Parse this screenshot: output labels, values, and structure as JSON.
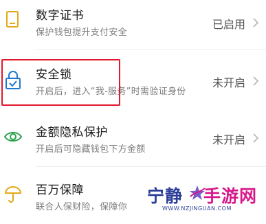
{
  "settings": {
    "items": [
      {
        "title": "数字证书",
        "subtitle": "保护钱包提升支付安全",
        "status": "已启用",
        "icon": "certificate-icon",
        "icon_color": "#e6a817"
      },
      {
        "title": "安全锁",
        "subtitle": "开启后，进入“我-服务”时需验证身份",
        "status": "未开启",
        "icon": "lock-icon",
        "icon_color": "#1e7ad0"
      },
      {
        "title": "金额隐私保护",
        "subtitle": "开启后可隐藏钱包下方金额",
        "status": "未开启",
        "icon": "eye-icon",
        "icon_color": "#2aa34a"
      },
      {
        "title": "百万保障",
        "subtitle": "联合人保财险，保障你",
        "status": "",
        "icon": "umbrella-icon",
        "icon_color": "#e6a817"
      }
    ]
  },
  "highlight_color": "#e4162b",
  "watermark": {
    "brand_part1": "宁静",
    "brand_part2": "手游网",
    "url": "WWW.NZJINGUAN.COM"
  }
}
